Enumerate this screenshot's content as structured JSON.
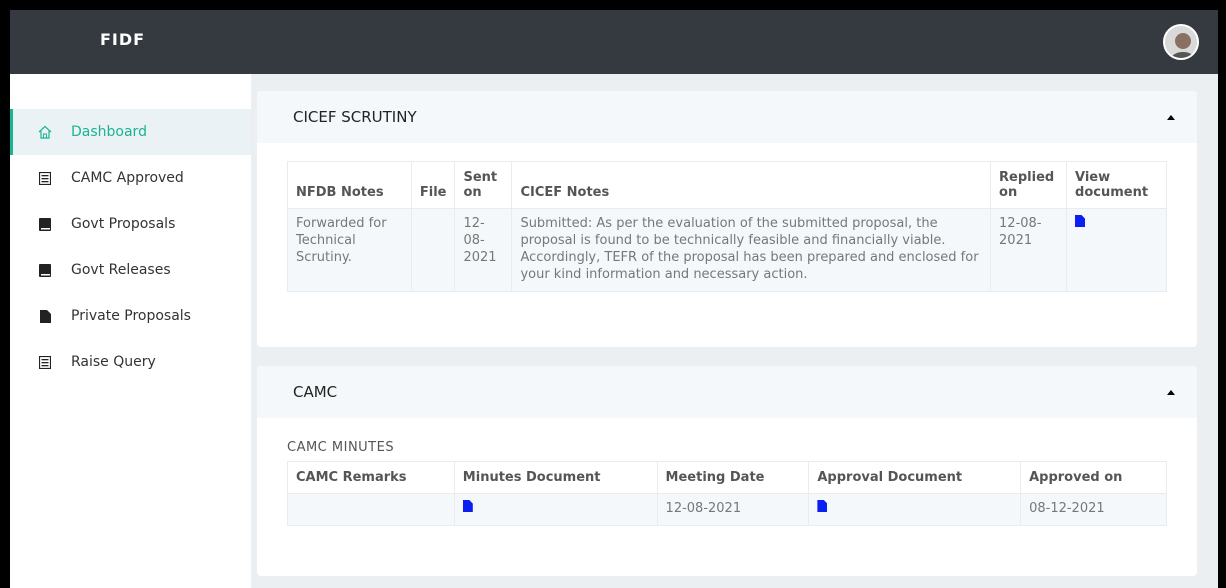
{
  "app": {
    "brand": "FIDF"
  },
  "sidebar": {
    "items": [
      {
        "label": "Dashboard",
        "icon": "home-icon",
        "active": true
      },
      {
        "label": "CAMC Approved",
        "icon": "list-icon"
      },
      {
        "label": "Govt Proposals",
        "icon": "book-icon"
      },
      {
        "label": "Govt Releases",
        "icon": "book-icon"
      },
      {
        "label": "Private Proposals",
        "icon": "file-icon"
      },
      {
        "label": "Raise Query",
        "icon": "list-icon"
      }
    ]
  },
  "scrutiny": {
    "title": "CICEF SCRUTINY",
    "headers": [
      "NFDB Notes",
      "File",
      "Sent on",
      "CICEF Notes",
      "Replied on",
      "View document"
    ],
    "row": {
      "nfdb_notes": "Forwarded for Technical Scrutiny.",
      "file": "",
      "sent_on": "12-08-2021",
      "cicef_notes": "Submitted: As per the evaluation of the submitted proposal, the proposal is found to be technically feasible and financially viable. Accordingly, TEFR of the proposal has been prepared and enclosed for your kind information and necessary action.",
      "replied_on": "12-08-2021"
    }
  },
  "camc": {
    "title": "CAMC",
    "subtitle": "CAMC MINUTES",
    "headers": [
      "CAMC Remarks",
      "Minutes Document",
      "Meeting Date",
      "Approval Document",
      "Approved on"
    ],
    "row": {
      "remarks": "",
      "meeting_date": "12-08-2021",
      "approved_on": "08-12-2021"
    }
  },
  "colors": {
    "topbar": "#343a40",
    "accent": "#1bb394",
    "doc_icon": "#0b1ff2"
  }
}
